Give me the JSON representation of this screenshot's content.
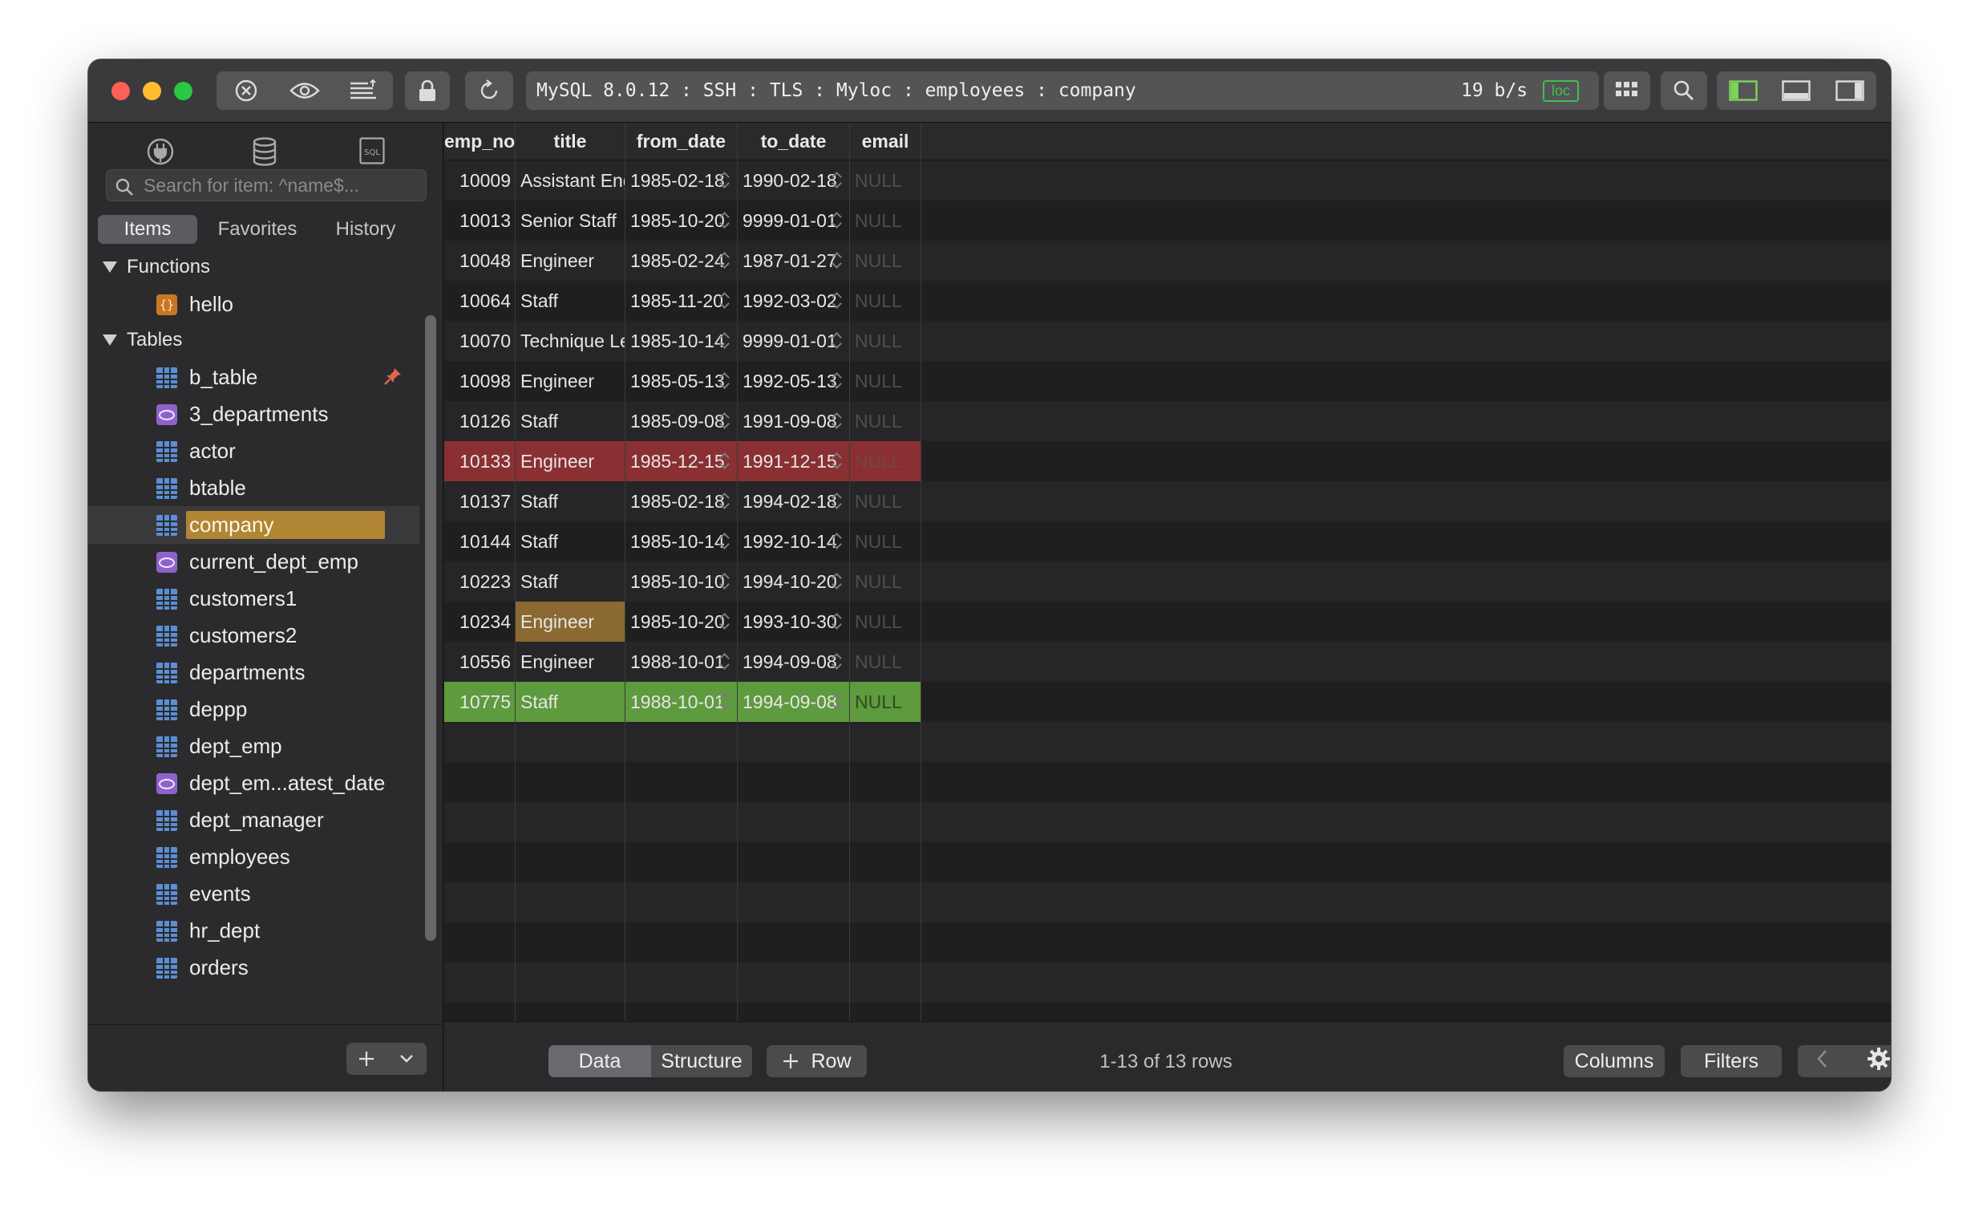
{
  "toolbar": {
    "connection_title": "MySQL 8.0.12 : SSH : TLS : Myloc : employees : company",
    "transfer_rate": "19 b/s",
    "badge": "loc"
  },
  "sidebar": {
    "search_placeholder": "Search for item: ^name$...",
    "tabs": [
      "Items",
      "Favorites",
      "History"
    ],
    "sections": [
      {
        "label": "Functions",
        "items": [
          {
            "label": "hello",
            "kind": "function-icon"
          }
        ]
      },
      {
        "label": "Tables",
        "items": [
          {
            "label": "b_table",
            "kind": "table-icon",
            "pinned": true
          },
          {
            "label": "3_departments",
            "kind": "view-icon"
          },
          {
            "label": "actor",
            "kind": "table-icon"
          },
          {
            "label": "btable",
            "kind": "table-icon"
          },
          {
            "label": "company",
            "kind": "table-icon",
            "selected": true
          },
          {
            "label": "current_dept_emp",
            "kind": "view-icon"
          },
          {
            "label": "customers1",
            "kind": "table-icon"
          },
          {
            "label": "customers2",
            "kind": "table-icon"
          },
          {
            "label": "departments",
            "kind": "table-icon"
          },
          {
            "label": "deppp",
            "kind": "table-icon"
          },
          {
            "label": "dept_emp",
            "kind": "table-icon"
          },
          {
            "label": "dept_em...atest_date",
            "kind": "view-icon"
          },
          {
            "label": "dept_manager",
            "kind": "table-icon"
          },
          {
            "label": "employees",
            "kind": "table-icon"
          },
          {
            "label": "events",
            "kind": "table-icon"
          },
          {
            "label": "hr_dept",
            "kind": "table-icon"
          },
          {
            "label": "orders",
            "kind": "table-icon"
          }
        ]
      }
    ]
  },
  "grid": {
    "columns": [
      "emp_no",
      "title",
      "from_date",
      "to_date",
      "email"
    ],
    "rows": [
      {
        "emp_no": "10009",
        "title": "Assistant Engineer",
        "from_date": "1985-02-18",
        "to_date": "1990-02-18",
        "email": "NULL"
      },
      {
        "emp_no": "10013",
        "title": "Senior Staff",
        "from_date": "1985-10-20",
        "to_date": "9999-01-01",
        "email": "NULL"
      },
      {
        "emp_no": "10048",
        "title": "Engineer",
        "from_date": "1985-02-24",
        "to_date": "1987-01-27",
        "email": "NULL"
      },
      {
        "emp_no": "10064",
        "title": "Staff",
        "from_date": "1985-11-20",
        "to_date": "1992-03-02",
        "email": "NULL"
      },
      {
        "emp_no": "10070",
        "title": "Technique Leader",
        "from_date": "1985-10-14",
        "to_date": "9999-01-01",
        "email": "NULL"
      },
      {
        "emp_no": "10098",
        "title": "Engineer",
        "from_date": "1985-05-13",
        "to_date": "1992-05-13",
        "email": "NULL"
      },
      {
        "emp_no": "10126",
        "title": "Staff",
        "from_date": "1985-09-08",
        "to_date": "1991-09-08",
        "email": "NULL"
      },
      {
        "emp_no": "10133",
        "title": "Engineer",
        "from_date": "1985-12-15",
        "to_date": "1991-12-15",
        "email": "NULL",
        "state": "deleted"
      },
      {
        "emp_no": "10137",
        "title": "Staff",
        "from_date": "1985-02-18",
        "to_date": "1994-02-18",
        "email": "NULL"
      },
      {
        "emp_no": "10144",
        "title": "Staff",
        "from_date": "1985-10-14",
        "to_date": "1992-10-14",
        "email": "NULL"
      },
      {
        "emp_no": "10223",
        "title": "Staff",
        "from_date": "1985-10-10",
        "to_date": "1994-10-20",
        "email": "NULL"
      },
      {
        "emp_no": "10234",
        "title": "Engineer",
        "from_date": "1985-10-20",
        "to_date": "1993-10-30",
        "email": "NULL",
        "edited_cell": "title"
      },
      {
        "emp_no": "10556",
        "title": "Engineer",
        "from_date": "1988-10-01",
        "to_date": "1994-09-08",
        "email": "NULL"
      },
      {
        "emp_no": "10775",
        "title": "Staff",
        "from_date": "1988-10-01",
        "to_date": "1994-09-08",
        "email": "NULL",
        "state": "inserted"
      }
    ]
  },
  "bottombar": {
    "data_label": "Data",
    "structure_label": "Structure",
    "add_row_label": "Row",
    "row_count": "1-13 of 13 rows",
    "columns_label": "Columns",
    "filters_label": "Filters"
  },
  "colors": {
    "deleted_row": "#8a3032",
    "inserted_row": "#5e9a3e",
    "edited_cell": "#8a6a32",
    "selected_item": "#b08533",
    "badge_green": "#3fbf4c"
  }
}
